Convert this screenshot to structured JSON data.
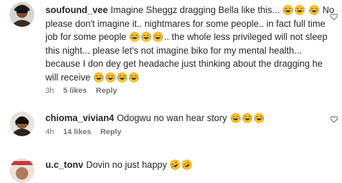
{
  "comments": [
    {
      "username": "soufound_vee",
      "text": "Imagine Sheggz dragging Bella like this...",
      "text2": "No please don't imagine it.. nightmares for some people.. in fact full time job for some people",
      "text3": ".. the whole less privileged will not sleep this night... please let's not imagine biko for my mental health... because I don dey get headache just thinking about the dragging he will receive",
      "time": "3h",
      "likes": "5 likes",
      "reply": "Reply"
    },
    {
      "username": "chioma_vivian4",
      "text": "Odogwu no wan hear story",
      "time": "4h",
      "likes": "14 likes",
      "reply": "Reply"
    },
    {
      "username": "u.c_tonv",
      "text": "Dovin no just happy"
    }
  ],
  "icons": {
    "heart": "heart-outline-icon",
    "emoji_laugh": "face-with-tears-of-joy-icon",
    "emoji_rofl": "rolling-on-floor-laughing-icon"
  },
  "colors": {
    "meta": "#737373",
    "text": "#262626"
  }
}
